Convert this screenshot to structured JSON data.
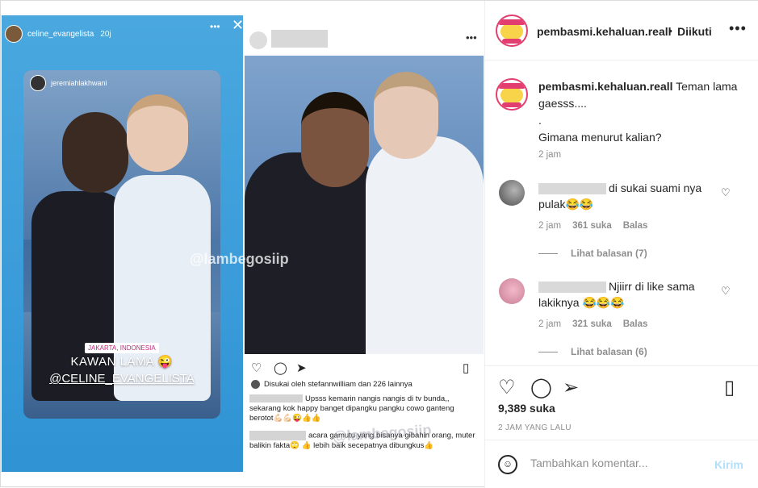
{
  "story": {
    "username": "celine_evangelista",
    "time": "20j",
    "more": "•••",
    "close": "✕",
    "inner_username": "jeremiahlakhwani",
    "location": "JAKARTA, INDONESIA",
    "caption_line1": "KAWAN LAMA 😜",
    "caption_line2": "@CELINE_EVANGELISTA",
    "watermark": "@lambegosiip"
  },
  "embedded_post": {
    "more": "•••",
    "liked_by": "Disukai oleh stefannwilliam dan 226 lainnya",
    "caption1": "Upsss kemarin nangis nangis di tv bunda,, sekarang kok happy banget dipangku pangku cowo ganteng berotot💪🏻💪🏻😜👍👍",
    "caption2": "acara gamutu yang bisanya gibahin orang, muter balikin fakta🙄 👍 lebih baik secepatnya dibungkus👍",
    "watermark": "@lambegosiip"
  },
  "header": {
    "username": "pembasmi.kehaluan.reall",
    "separator": "•",
    "follow_status": "Diikuti",
    "more": "•••"
  },
  "caption": {
    "username": "pembasmi.kehaluan.reall",
    "line1": "Teman lama",
    "line2": "gaesss....",
    "line3": ".",
    "line4": "Gimana menurut kalian?",
    "time": "2 jam"
  },
  "comments": [
    {
      "text": "di sukai suami nya pulak😂😂",
      "time": "2 jam",
      "likes": "361 suka",
      "reply": "Balas",
      "view_replies": "Lihat balasan (7)"
    },
    {
      "text": "Njiirr di like sama lakiknya 😂😂😂",
      "time": "2 jam",
      "likes": "321 suka",
      "reply": "Balas",
      "view_replies": "Lihat balasan (6)"
    }
  ],
  "actions": {
    "likes": "9,389 suka",
    "posted_ago": "2 JAM YANG LALU"
  },
  "composer": {
    "placeholder": "Tambahkan komentar...",
    "send": "Kirim"
  }
}
